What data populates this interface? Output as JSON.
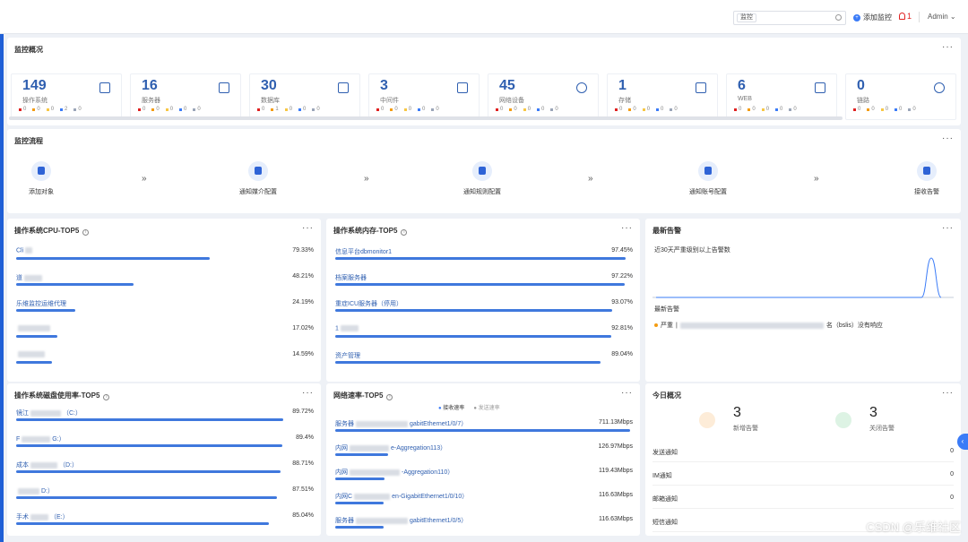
{
  "topbar": {
    "search_select": "监控",
    "search_placeholder": "",
    "add_label": "添加监控",
    "alert_count": "1",
    "user": "Admin"
  },
  "overview": {
    "title": "监控概况",
    "more": "···",
    "cards": [
      {
        "num": "149",
        "label": "操作系统",
        "icon": "os-icon",
        "dots": [
          "0",
          "0",
          "0",
          "2",
          "0"
        ]
      },
      {
        "num": "16",
        "label": "服务器",
        "icon": "server-icon",
        "dots": [
          "0",
          "0",
          "0",
          "0",
          "0"
        ]
      },
      {
        "num": "30",
        "label": "数据库",
        "icon": "database-icon",
        "dots": [
          "0",
          "1",
          "0",
          "0",
          "0"
        ]
      },
      {
        "num": "3",
        "label": "中间件",
        "icon": "middleware-icon",
        "dots": [
          "0",
          "0",
          "0",
          "0",
          "0"
        ]
      },
      {
        "num": "45",
        "label": "网络设备",
        "icon": "globe-icon",
        "dots": [
          "0",
          "0",
          "0",
          "0",
          "0"
        ]
      },
      {
        "num": "1",
        "label": "存储",
        "icon": "storage-icon",
        "dots": [
          "0",
          "0",
          "0",
          "0",
          "0"
        ]
      },
      {
        "num": "6",
        "label": "WEB",
        "icon": "web-icon",
        "dots": [
          "0",
          "0",
          "0",
          "0",
          "0"
        ]
      },
      {
        "num": "0",
        "label": "链路",
        "icon": "link-icon",
        "dots": [
          "0",
          "0",
          "0",
          "0",
          "0"
        ]
      }
    ],
    "dot_colors": [
      "#e02020",
      "#f39c12",
      "#f7c744",
      "#3a7bf7",
      "#9aa5b8"
    ]
  },
  "flow": {
    "title": "监控流程",
    "more": "···",
    "steps": [
      "添加对象",
      "通知媒介配置",
      "通知规则配置",
      "通知账号配置",
      "接收告警"
    ],
    "arrow": "»"
  },
  "cpu": {
    "title": "操作系统CPU-TOP5",
    "more": "···",
    "rows": [
      {
        "name": "Cli",
        "value": "79.33%",
        "pct": 79.33
      },
      {
        "name": "道",
        "value": "48.21%",
        "pct": 48.21
      },
      {
        "name": "乐维监控运维代理",
        "value": "24.19%",
        "pct": 24.19
      },
      {
        "name": "",
        "value": "17.02%",
        "pct": 17.02
      },
      {
        "name": "",
        "value": "14.59%",
        "pct": 14.59
      }
    ]
  },
  "mem": {
    "title": "操作系统内存-TOP5",
    "more": "···",
    "rows": [
      {
        "name": "信息平台dbmonitor1",
        "value": "97.45%",
        "pct": 97.45
      },
      {
        "name": "档案服务器",
        "value": "97.22%",
        "pct": 97.22
      },
      {
        "name": "重症ICU服务器（停用）",
        "value": "93.07%",
        "pct": 93.07
      },
      {
        "name": "1",
        "value": "92.81%",
        "pct": 92.81
      },
      {
        "name": "资产管理",
        "value": "89.04%",
        "pct": 89.04
      }
    ]
  },
  "alarm": {
    "title": "最新告警",
    "more": "···",
    "subtitle": "近30天严重级别以上告警数",
    "latest_label": "最新告警",
    "item_level": "严重",
    "item_text": "名（bslis）没有响应"
  },
  "disk": {
    "title": "操作系统磁盘使用率-TOP5",
    "more": "···",
    "rows": [
      {
        "name": "镜江",
        "suffix": "（C:）",
        "value": "89.72%",
        "pct": 89.72
      },
      {
        "name": "F",
        "suffix": "G:）",
        "value": "89.4%",
        "pct": 89.4
      },
      {
        "name": "成本",
        "suffix": "（D:）",
        "value": "88.71%",
        "pct": 88.71
      },
      {
        "name": "",
        "suffix": "D:）",
        "value": "87.51%",
        "pct": 87.51
      },
      {
        "name": "手术",
        "suffix": "（E:）",
        "value": "85.04%",
        "pct": 85.04
      }
    ]
  },
  "net": {
    "title": "网络速率-TOP5",
    "more": "···",
    "legend_recv": "接收速率",
    "legend_send": "发送速率",
    "rows": [
      {
        "name": "服务器",
        "suffix": "gabitEthernet1/0/7）",
        "value": "711.13Mbps",
        "pct": 100
      },
      {
        "name": "内网",
        "suffix": "e-Aggregation113）",
        "value": "126.97Mbps",
        "pct": 17.8
      },
      {
        "name": "内网",
        "suffix": "-Aggregation110）",
        "value": "119.43Mbps",
        "pct": 16.8
      },
      {
        "name": "内网C",
        "suffix": "en-GigabitEthernet1/0/10）",
        "value": "116.63Mbps",
        "pct": 16.4
      },
      {
        "name": "服务器",
        "suffix": "gabitEthernet1/0/5）",
        "value": "116.63Mbps",
        "pct": 16.4
      }
    ]
  },
  "today": {
    "title": "今日概况",
    "more": "···",
    "new_count": "3",
    "new_label": "新增告警",
    "closed_count": "3",
    "closed_label": "关闭告警",
    "rows": [
      {
        "label": "发送通知",
        "value": "0"
      },
      {
        "label": "IM通知",
        "value": "0"
      },
      {
        "label": "邮箱通知",
        "value": "0"
      },
      {
        "label": "短信通知",
        "value": ""
      }
    ]
  },
  "watermark": "CSDN @乐维社区",
  "chart_data": {
    "type": "line",
    "title": "近30天严重级别以上告警数",
    "series": [
      {
        "values": [
          0,
          0,
          0,
          0,
          0,
          0,
          0,
          0,
          0,
          0,
          0,
          0,
          0,
          0,
          0,
          0,
          0,
          0,
          0,
          0,
          0,
          0,
          0,
          0,
          0,
          0,
          0,
          0,
          1,
          0
        ]
      }
    ],
    "note_colors": {
      "line": "#3a7bf7"
    }
  }
}
